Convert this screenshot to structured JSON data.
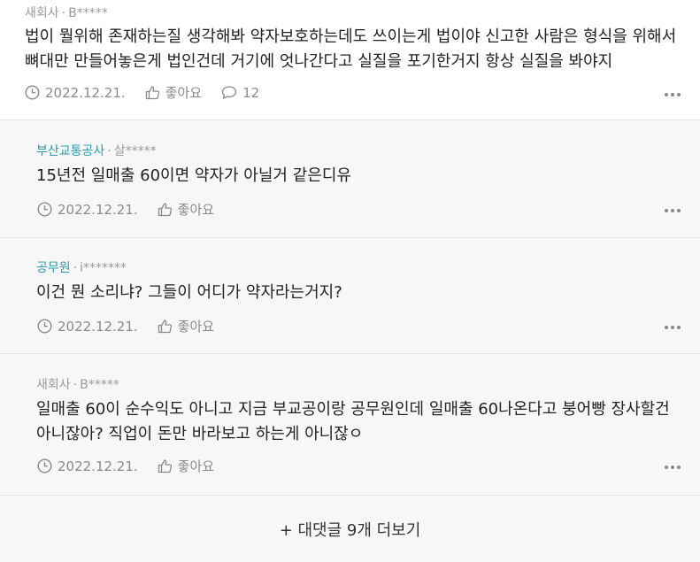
{
  "comments": [
    {
      "affiliation": "새회사",
      "user": "B*****",
      "text": "법이 뭘위해 존재하는질 생각해봐 약자보호하는데도 쓰이는게 법이야 신고한 사람은 형식을 위해서\n뼈대만 만들어놓은게 법인건데 거기에 엇나간다고 실질을 포기한거지 항상 실질을 봐야지",
      "date": "2022.12.21.",
      "like_label": "좋아요",
      "reply_count": "12"
    }
  ],
  "replies": [
    {
      "affiliation": "부산교통공사",
      "user": "살*****",
      "text": "15년전 일매출 60이면 약자가 아닐거 같은디유",
      "date": "2022.12.21.",
      "like_label": "좋아요"
    },
    {
      "affiliation": "공무원",
      "user": "i*******",
      "text": "이건 뭔 소리냐? 그들이 어디가 약자라는거지?",
      "date": "2022.12.21.",
      "like_label": "좋아요"
    },
    {
      "affiliation": "새회사",
      "user": "B*****",
      "text": "일매출 60이 순수익도 아니고 지금 부교공이랑 공무원인데 일매출 60나온다고 붕어빵 장사할건\n아니잖아? 직업이 돈만 바라보고 하는게 아니잖ㅇ",
      "date": "2022.12.21.",
      "like_label": "좋아요"
    }
  ],
  "separator": "·",
  "load_more_label": "+ 대댓글 9개 더보기",
  "colors": {
    "affiliation_accent": "#2a9bb0",
    "reply_bg": "#f7f7f7",
    "meta_gray": "#9a9a9a"
  },
  "icons": [
    "clock-icon",
    "thumbs-up-icon",
    "speech-bubble-icon",
    "more-dots-icon"
  ]
}
